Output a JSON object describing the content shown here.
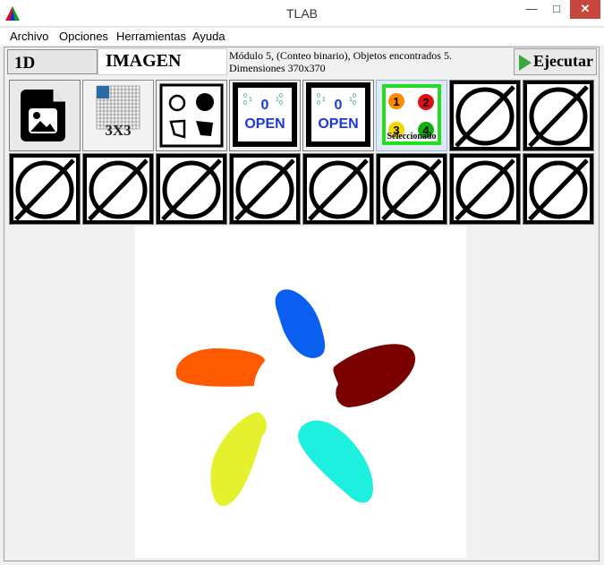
{
  "window": {
    "title": "TLAB"
  },
  "menu": [
    "Archivo",
    "Opciones",
    "Herramientas",
    "Ayuda"
  ],
  "tabs": {
    "one_d": "1D",
    "image": "IMAGEN"
  },
  "info": {
    "line1": "Módulo 5, (Conteo binario), Objetos encontrados 5.",
    "line2": "Dimensiones 370x370"
  },
  "toolbar": {
    "run_label": "Ejecutar"
  },
  "tiles": {
    "grid_label": "3X3",
    "open_label": "OPEN",
    "open_digit": "0",
    "selected_label": "Seleccionado",
    "count_digits": [
      "1",
      "2",
      "3",
      "4"
    ]
  },
  "colors": {
    "close_button": "#c7463d",
    "selected_border": "#22dd22",
    "petal_blue": "#0a5ff0",
    "petal_maroon": "#7a0000",
    "petal_orange": "#ff5a00",
    "petal_yellow": "#e6f12e",
    "petal_cyan": "#1ef0e0"
  },
  "canvas": {
    "objects_found": 5
  }
}
